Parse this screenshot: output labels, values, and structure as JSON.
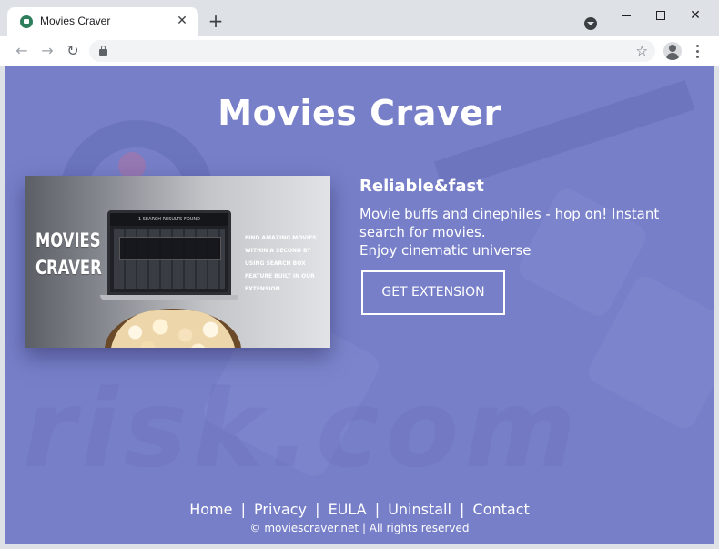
{
  "browser": {
    "tab_title": "Movies Craver",
    "tab_close": "✕",
    "new_tab": "+",
    "nav": {
      "back": "←",
      "forward": "→",
      "reload": "↻"
    },
    "bookmark": "☆",
    "window": {
      "close": "✕"
    }
  },
  "page": {
    "headline": "Movies Craver",
    "promo": {
      "logo_line1": "MOVIES",
      "logo_line2": "CRAVER",
      "screen_header": "1 SEARCH RESULTS FOUND",
      "tagline": "Find amazing movies within a second by using search box feature built in our extension"
    },
    "info": {
      "title": "Reliable&fast",
      "line1": "Movie buffs and cinephiles - hop on! Instant search for movies.",
      "line2": "Enjoy cinematic universe"
    },
    "cta_label": "GET EXTENSION",
    "footer": {
      "links": [
        "Home",
        "Privacy",
        "EULA",
        "Uninstall",
        "Contact"
      ],
      "separator": "|",
      "copyright": "© moviescraver.net | All rights reserved"
    },
    "watermark": "risk.com"
  },
  "colors": {
    "page_background": "#777fc8",
    "text": "#ffffff",
    "chrome": "#dee1e6"
  }
}
